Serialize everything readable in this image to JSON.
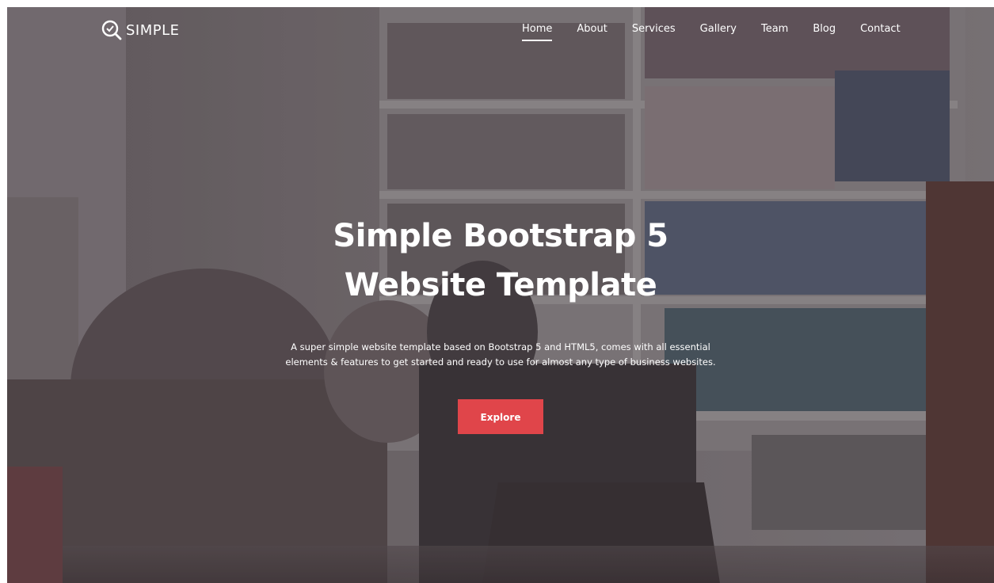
{
  "brand": {
    "name": "SIMPLE",
    "icon": "magnifier-logo-icon"
  },
  "nav": {
    "items": [
      {
        "label": "Home",
        "active": true
      },
      {
        "label": "About",
        "active": false
      },
      {
        "label": "Services",
        "active": false
      },
      {
        "label": "Gallery",
        "active": false
      },
      {
        "label": "Team",
        "active": false
      },
      {
        "label": "Blog",
        "active": false
      },
      {
        "label": "Contact",
        "active": false
      }
    ]
  },
  "hero": {
    "title_line1": "Simple Bootstrap 5",
    "title_line2": "Website Template",
    "subtitle_line1": "A super simple website template based on Bootstrap 5 and HTML5, comes with all essential",
    "subtitle_line2": "elements & features to get started and ready to use for almost any type of business websites.",
    "cta_label": "Explore",
    "background": "office-team-laughing-at-laptop-photo"
  },
  "colors": {
    "cta": "#e0454a",
    "text": "#ffffff"
  }
}
